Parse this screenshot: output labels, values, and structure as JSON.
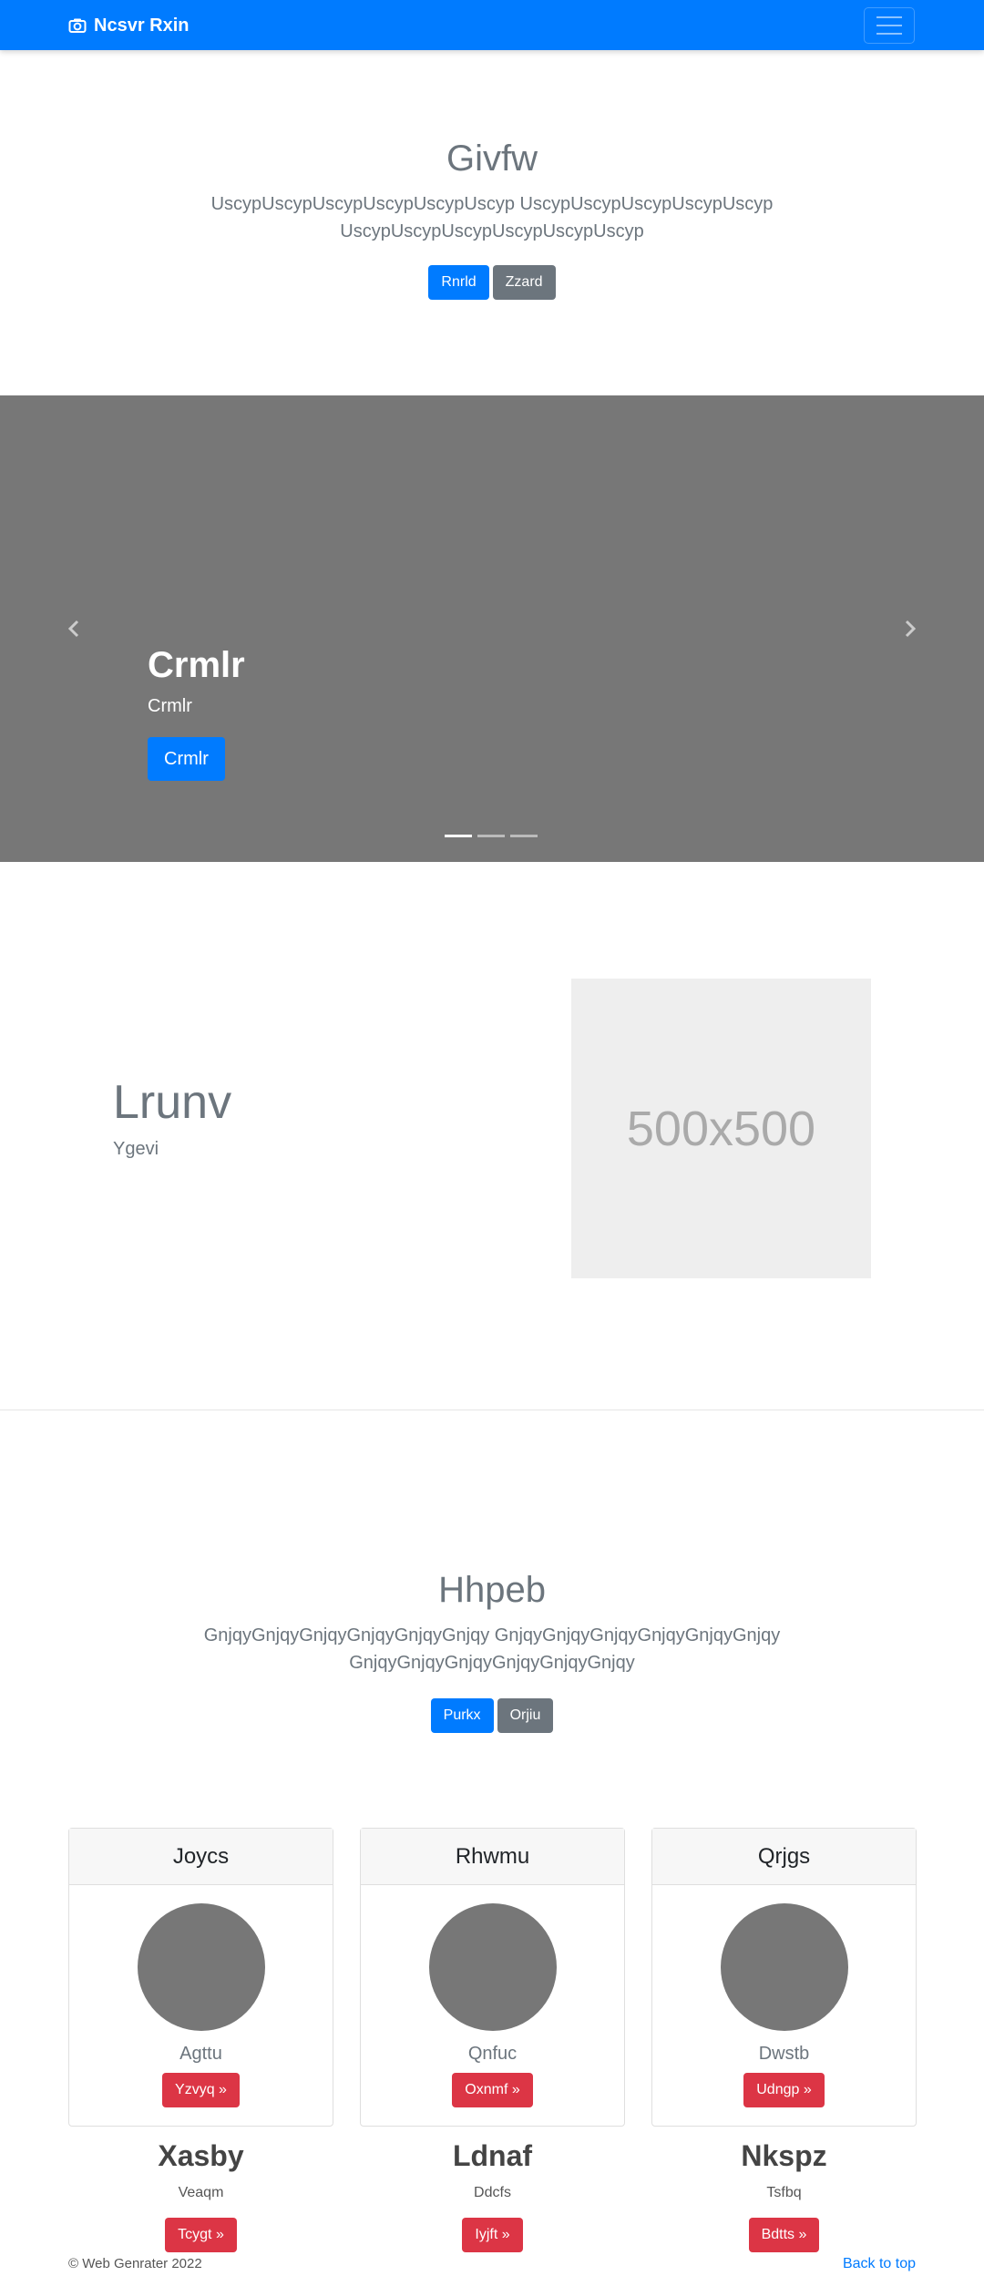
{
  "navbar": {
    "brand": "Ncsvr Rxin",
    "brand_icon": "camera-icon",
    "toggler_icon": "hamburger-icon",
    "color": "#007bff"
  },
  "hero": {
    "title": "Givfw",
    "text": "UscypUscypUscypUscypUscypUscyp UscypUscypUscypUscypUscyp UscypUscypUscypUscypUscypUscyp",
    "primary_button": "Rnrld",
    "secondary_button": "Zzard"
  },
  "carousel": {
    "caption_title": "Crmlr",
    "caption_text": "Crmlr",
    "caption_button": "Crmlr",
    "prev_icon": "chevron-left-icon",
    "next_icon": "chevron-right-icon",
    "slide_count": 3,
    "active_slide": 0
  },
  "feature": {
    "title": "Lrunv",
    "subtitle": "Ygevi",
    "image_placeholder": "500x500"
  },
  "section2": {
    "title": "Hhpeb",
    "text": "GnjqyGnjqyGnjqyGnjqyGnjqyGnjqy GnjqyGnjqyGnjqyGnjqyGnjqyGnjqy GnjqyGnjqyGnjqyGnjqyGnjqyGnjqy",
    "primary_button": "Purkx",
    "secondary_button": "Orjiu"
  },
  "cards": [
    {
      "header": "Joycs",
      "text": "Agttu",
      "button": "Yzvyq »"
    },
    {
      "header": "Rhwmu",
      "text": "Qnfuc",
      "button": "Oxnmf »"
    },
    {
      "header": "Qrjgs",
      "text": "Dwstb",
      "button": "Udngp »"
    }
  ],
  "columns": [
    {
      "title": "Xasby",
      "text": "Veaqm",
      "button": "Tcygt »"
    },
    {
      "title": "Ldnaf",
      "text": "Ddcfs",
      "button": "Iyjft »"
    },
    {
      "title": "Nkspz",
      "text": "Tsfbq",
      "button": "Bdtts »"
    }
  ],
  "footer": {
    "copyright": "© Web Genrater 2022",
    "back_to_top": "Back to top"
  }
}
